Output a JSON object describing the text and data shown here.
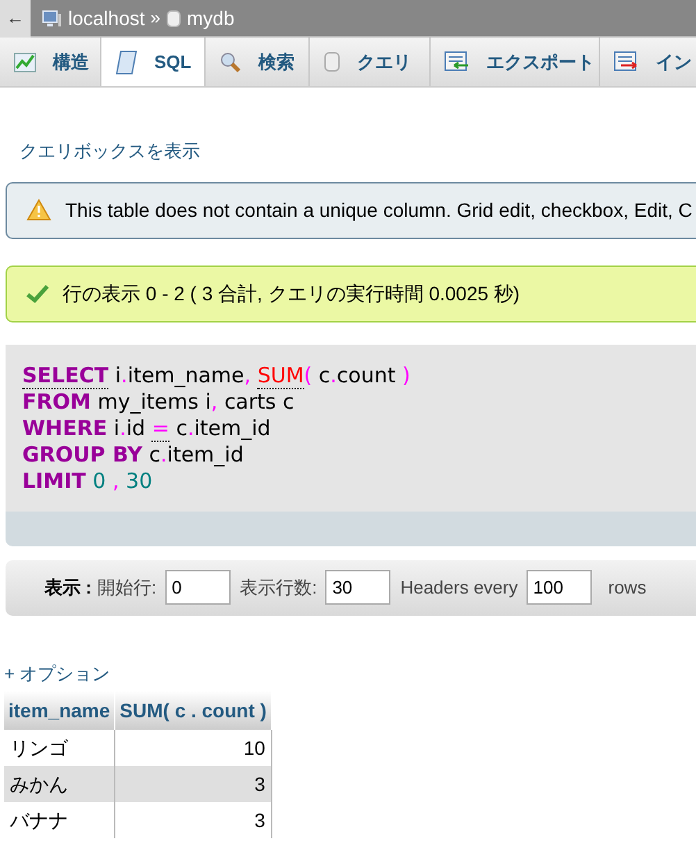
{
  "breadcrumb": [
    {
      "kind": "server",
      "label": "localhost"
    },
    {
      "kind": "database",
      "label": "mydb"
    }
  ],
  "back_button": "←",
  "separator": "»",
  "tabs": [
    {
      "label": "構造",
      "kind": "structure",
      "selected": false
    },
    {
      "label": "SQL",
      "kind": "sql",
      "selected": true
    },
    {
      "label": "検索",
      "kind": "search",
      "selected": false
    },
    {
      "label": "クエリ",
      "kind": "query",
      "selected": false
    },
    {
      "label": "エクスポート",
      "kind": "export",
      "selected": false
    },
    {
      "label": "イン",
      "kind": "import",
      "selected": false
    }
  ],
  "show_query_box_link": "クエリボックスを表示",
  "notices": [
    {
      "kind": "warning",
      "text": "This table does not contain a unique column. Grid edit, checkbox, Edit, C"
    },
    {
      "kind": "success",
      "text": "行の表示 0 - 2 ( 3 合計, クエリの実行時間 0.0025 秒)"
    }
  ],
  "sql_lines": [
    [
      {
        "kind": "keyword_doc",
        "text": "SELECT"
      },
      {
        "kind": "text",
        "text": " i"
      },
      {
        "kind": "punct",
        "text": "."
      },
      {
        "kind": "text",
        "text": "item_name"
      },
      {
        "kind": "punct",
        "text": ", "
      },
      {
        "kind": "function_doc",
        "text": "SUM"
      },
      {
        "kind": "punct",
        "text": "( "
      },
      {
        "kind": "text",
        "text": "c"
      },
      {
        "kind": "punct",
        "text": "."
      },
      {
        "kind": "text",
        "text": "count "
      },
      {
        "kind": "punct",
        "text": ")"
      }
    ],
    [
      {
        "kind": "keyword",
        "text": "FROM"
      },
      {
        "kind": "text",
        "text": " my_items i"
      },
      {
        "kind": "punct",
        "text": ", "
      },
      {
        "kind": "text",
        "text": "carts c"
      }
    ],
    [
      {
        "kind": "keyword",
        "text": "WHERE"
      },
      {
        "kind": "text",
        "text": " i"
      },
      {
        "kind": "punct",
        "text": "."
      },
      {
        "kind": "text",
        "text": "id "
      },
      {
        "kind": "operator_doc",
        "text": "="
      },
      {
        "kind": "text",
        "text": " c"
      },
      {
        "kind": "punct",
        "text": "."
      },
      {
        "kind": "text",
        "text": "item_id"
      }
    ],
    [
      {
        "kind": "keyword",
        "text": "GROUP BY"
      },
      {
        "kind": "text",
        "text": " c"
      },
      {
        "kind": "punct",
        "text": "."
      },
      {
        "kind": "text",
        "text": "item_id"
      }
    ],
    [
      {
        "kind": "keyword",
        "text": "LIMIT"
      },
      {
        "kind": "number",
        "text": " 0 "
      },
      {
        "kind": "punct",
        "text": ", "
      },
      {
        "kind": "number",
        "text": "30"
      }
    ]
  ],
  "navigation": {
    "label": "表示 :",
    "fields": [
      {
        "label": "開始行:",
        "value": "0"
      },
      {
        "label": "表示行数:",
        "value": "30"
      },
      {
        "label": "Headers every",
        "value": "100"
      }
    ],
    "suffix": "rows"
  },
  "options_link": "+ オプション",
  "table": {
    "columns": [
      "item_name",
      "SUM( c . count )"
    ],
    "rows": [
      [
        "リンゴ",
        "10"
      ],
      [
        "みかん",
        "3"
      ],
      [
        "バナナ",
        "3"
      ]
    ]
  }
}
